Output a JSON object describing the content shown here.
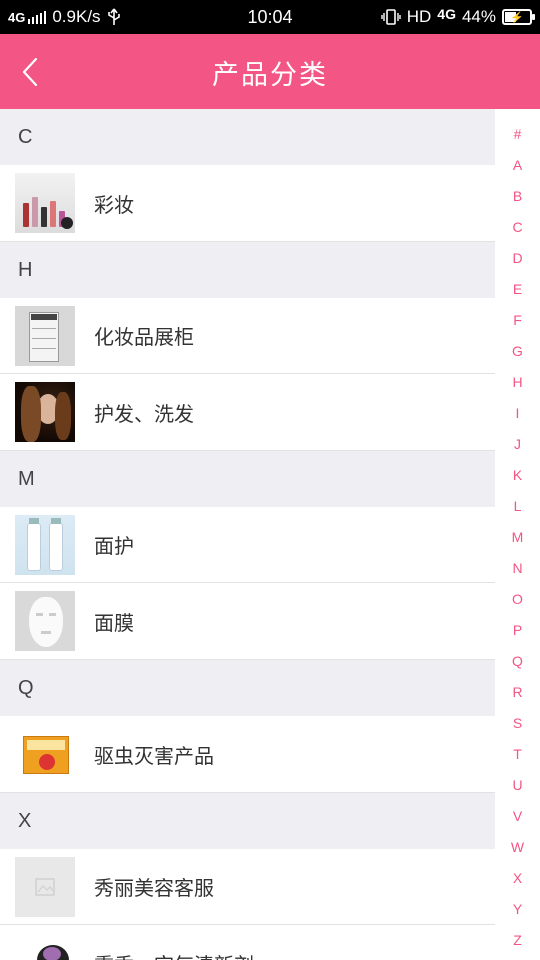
{
  "status_bar": {
    "network": "4G",
    "speed": "0.9K/s",
    "time": "10:04",
    "hd": "HD",
    "network2": "4G",
    "battery": "44%",
    "battery_level": 0.44
  },
  "header": {
    "title": "产品分类",
    "back_icon": "chevron-left-icon",
    "color": "#f35584"
  },
  "sections": [
    {
      "letter": "C",
      "items": [
        {
          "label": "彩妆",
          "thumb": "makeup"
        }
      ]
    },
    {
      "letter": "H",
      "items": [
        {
          "label": "化妆品展柜",
          "thumb": "cabinet"
        },
        {
          "label": "护发、洗发",
          "thumb": "hair"
        }
      ]
    },
    {
      "letter": "M",
      "items": [
        {
          "label": "面护",
          "thumb": "face"
        },
        {
          "label": "面膜",
          "thumb": "mask"
        }
      ]
    },
    {
      "letter": "Q",
      "items": [
        {
          "label": "驱虫灭害产品",
          "thumb": "pest"
        }
      ]
    },
    {
      "letter": "X",
      "items": [
        {
          "label": "秀丽美容客服",
          "thumb": "placeholder"
        },
        {
          "label": "熏香、空气清新剂",
          "thumb": "air"
        }
      ]
    }
  ],
  "index_letters": [
    "#",
    "A",
    "B",
    "C",
    "D",
    "E",
    "F",
    "G",
    "H",
    "I",
    "J",
    "K",
    "L",
    "M",
    "N",
    "O",
    "P",
    "Q",
    "R",
    "S",
    "T",
    "U",
    "V",
    "W",
    "X",
    "Y",
    "Z"
  ],
  "colors": {
    "accent": "#f35584",
    "section_bg": "#efeef3"
  }
}
